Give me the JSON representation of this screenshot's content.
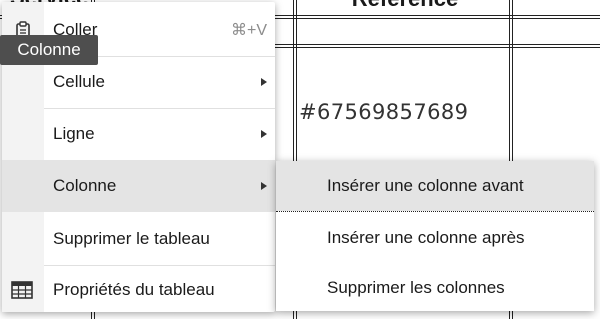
{
  "document": {
    "header_left": "Service",
    "header_reference": "Référence",
    "cell_reference": "#67569857689"
  },
  "tooltip": {
    "text": "Colonne"
  },
  "context_menu": {
    "items": [
      {
        "label": "Coller",
        "shortcut": "⌘+V",
        "icon": "clipboard-icon"
      },
      {
        "label": "Cellule",
        "submenu": true
      },
      {
        "label": "Ligne",
        "submenu": true
      },
      {
        "label": "Colonne",
        "submenu": true,
        "active": true
      },
      {
        "label": "Supprimer le tableau"
      },
      {
        "label": "Propriétés du tableau",
        "icon": "table-icon"
      }
    ]
  },
  "submenu": {
    "items": [
      {
        "label": "Insérer une colonne avant",
        "active": true
      },
      {
        "label": "Insérer une colonne après"
      },
      {
        "label": "Supprimer les colonnes"
      }
    ]
  },
  "colors": {
    "menu_bg": "#ffffff",
    "gutter_bg": "#f3f3f3",
    "active_bg": "#e4e4e4",
    "tooltip_bg": "#4e4e4e",
    "shortcut_text": "#8c8c8c"
  }
}
